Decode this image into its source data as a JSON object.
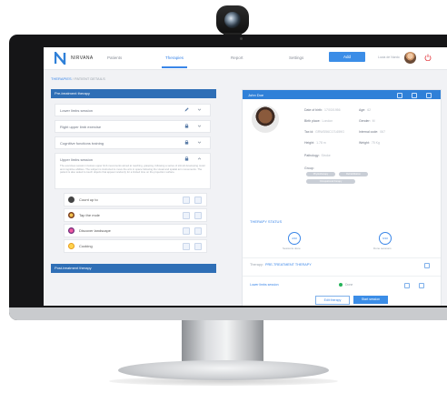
{
  "app": {
    "logo_text": "NIRVANA",
    "nav": [
      "Patients",
      "Therapies",
      "Report",
      "Settings"
    ],
    "active_nav": "Therapies",
    "add_label": "Add",
    "user_name": "Lucia de Nardo"
  },
  "breadcrumb": {
    "current": "THERAPIES",
    "rest": "/ PATIENT DETAILS"
  },
  "left": {
    "pre_title": "Pre-treatment therapy",
    "post_title": "Post-treatment therapy",
    "exercises": [
      "Lower limbs session",
      "Right upper limb exercise",
      "Cognitive functions training",
      "Upper limbs session"
    ],
    "description": "The exercises session involves upper limb movements aimed at reaching, grasping, following a series of stimuli developing motor and cognitive abilities. The subject is instructed to move the arm in space following the visual and spatial arm movements. The patient is also asked to touch objects that appear randomly for a limited time on the projection surface.",
    "sub_items": [
      "Count up to",
      "Tap the mole",
      "Discover landscape",
      "Cooking"
    ]
  },
  "right": {
    "patient_name": "John Doe",
    "fields": {
      "dob_label": "Date of birth:",
      "dob": "17/03/1956",
      "age_label": "Age:",
      "age": "62",
      "birthplace_label": "Birth place:",
      "birthplace": "London",
      "gender_label": "Gender:",
      "gender": "M",
      "taxid_label": "Tax id:",
      "taxid": "GRWD56C17L659G",
      "internal_label": "Internal code:",
      "internal": "067",
      "height_label": "Height:",
      "height": "1.78 m",
      "weight_label": "Weight:",
      "weight": "75 Kg",
      "pathology_label": "Pathology:",
      "pathology": "Stroke",
      "group_label": "Group:"
    },
    "groups": [
      "Physiotherapy",
      "Rehabilitation",
      "Occupational therapy"
    ],
    "status_title": "THERAPY STATUS",
    "sessions": [
      {
        "value": "4/10",
        "label": "Sessions done"
      },
      {
        "value": "6/10",
        "label": "Done sessions"
      }
    ],
    "therapy_label": "Therapy:",
    "therapy_name": "PRE-TREATMENT THERAPY",
    "session_row": {
      "name": "Lower limbs session",
      "status": "Done"
    },
    "edit_label": "Edit therapy",
    "start_label": "Start session"
  },
  "colors": {
    "accent": "#3a86e8",
    "header_bar": "#2f6fb6",
    "done": "#25b35a"
  }
}
